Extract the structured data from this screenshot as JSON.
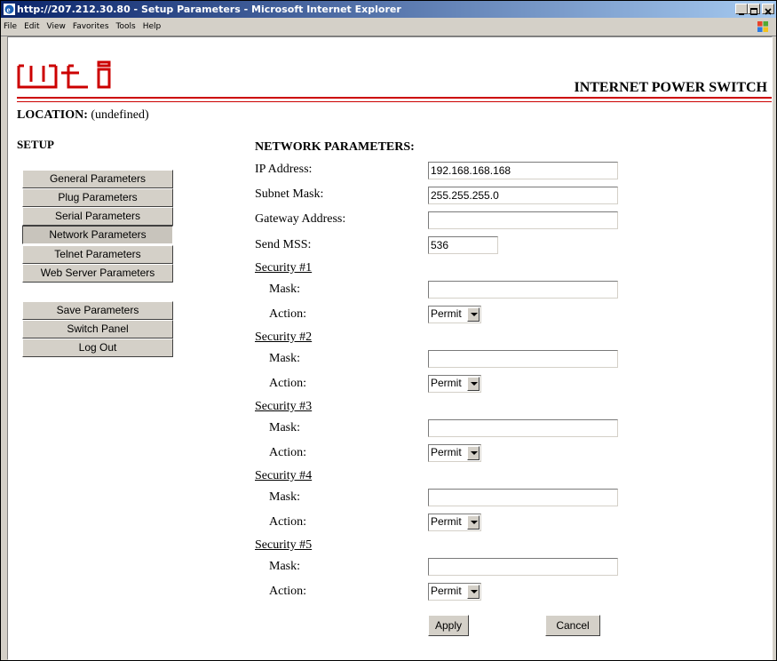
{
  "window": {
    "title": "http://207.212.30.80 - Setup Parameters - Microsoft Internet Explorer",
    "menu": [
      "File",
      "Edit",
      "View",
      "Favorites",
      "Tools",
      "Help"
    ]
  },
  "header": {
    "logo_text": "wti",
    "product": "INTERNET POWER SWITCH",
    "location_label": "LOCATION:",
    "location_value": "(undefined)"
  },
  "sidebar": {
    "title": "SETUP",
    "params": [
      {
        "label": "General Parameters"
      },
      {
        "label": "Plug Parameters"
      },
      {
        "label": "Serial Parameters"
      },
      {
        "label": "Network Parameters"
      },
      {
        "label": "Telnet Parameters"
      },
      {
        "label": "Web Server Parameters"
      }
    ],
    "actions": [
      {
        "label": "Save Parameters"
      },
      {
        "label": "Switch Panel"
      },
      {
        "label": "Log Out"
      }
    ]
  },
  "network": {
    "title": "NETWORK PARAMETERS:",
    "ip_label": "IP Address:",
    "ip_value": "192.168.168.168",
    "subnet_label": "Subnet Mask:",
    "subnet_value": "255.255.255.0",
    "gateway_label": "Gateway Address:",
    "gateway_value": "",
    "mss_label": "Send MSS:",
    "mss_value": "536",
    "security": [
      {
        "title": "Security #1",
        "mask_label": "Mask:",
        "mask_value": "",
        "action_label": "Action:",
        "action_value": "Permit"
      },
      {
        "title": "Security #2",
        "mask_label": "Mask:",
        "mask_value": "",
        "action_label": "Action:",
        "action_value": "Permit"
      },
      {
        "title": "Security #3",
        "mask_label": "Mask:",
        "mask_value": "",
        "action_label": "Action:",
        "action_value": "Permit"
      },
      {
        "title": "Security #4",
        "mask_label": "Mask:",
        "mask_value": "",
        "action_label": "Action:",
        "action_value": "Permit"
      },
      {
        "title": "Security #5",
        "mask_label": "Mask:",
        "mask_value": "",
        "action_label": "Action:",
        "action_value": "Permit"
      }
    ],
    "apply_label": "Apply",
    "cancel_label": "Cancel"
  },
  "colors": {
    "brand_red": "#cc0000",
    "titlebar": "#0a246a",
    "button_face": "#d4d0c8"
  }
}
